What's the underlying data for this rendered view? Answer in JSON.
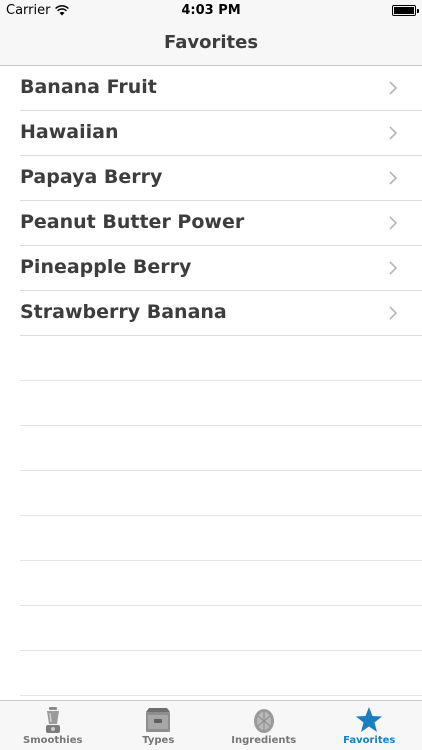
{
  "status_bar": {
    "carrier": "Carrier",
    "time": "4:03 PM",
    "battery_level": 1.0
  },
  "nav": {
    "title": "Favorites"
  },
  "favorites": [
    {
      "label": "Banana Fruit"
    },
    {
      "label": "Hawaiian"
    },
    {
      "label": "Papaya Berry"
    },
    {
      "label": "Peanut Butter Power"
    },
    {
      "label": "Pineapple Berry"
    },
    {
      "label": "Strawberry Banana"
    }
  ],
  "tabs": [
    {
      "label": "Smoothies",
      "icon": "blender-icon",
      "active": false
    },
    {
      "label": "Types",
      "icon": "filing-cabinet-icon",
      "active": false
    },
    {
      "label": "Ingredients",
      "icon": "fruit-icon",
      "active": false
    },
    {
      "label": "Favorites",
      "icon": "star-icon",
      "active": true
    }
  ],
  "colors": {
    "accent": "#1a7ec1",
    "text": "#3d3d3d",
    "inactive_tab": "#777777",
    "bar_background": "#f7f7f7"
  }
}
